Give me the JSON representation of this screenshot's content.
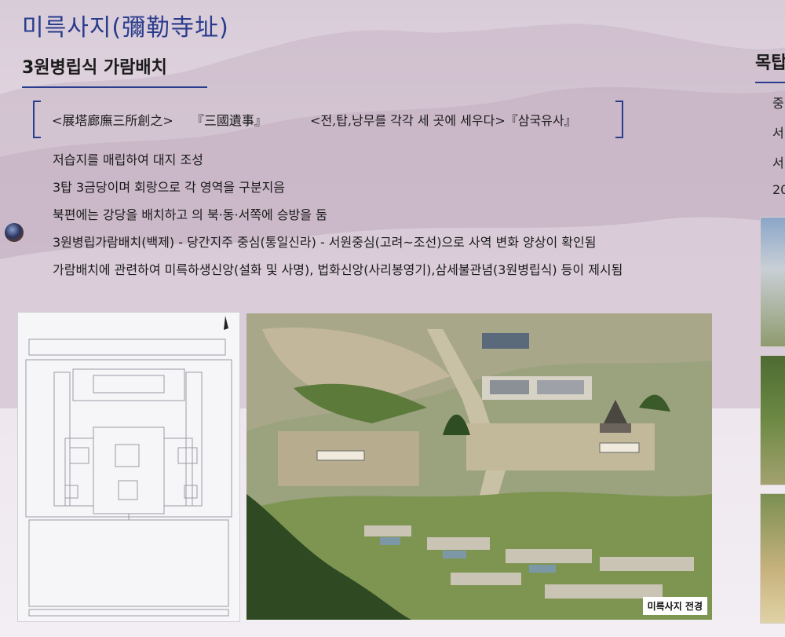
{
  "header": {
    "title": "미륵사지(彌勒寺址)",
    "subtitle": "3원병립식 가람배치",
    "right_title": "목탑",
    "right_lines": [
      "중",
      "서",
      "서",
      "20"
    ]
  },
  "quote": {
    "hanja": "<展塔廊廡三所創之>",
    "source_hanja": "『三國遺事』",
    "korean": "<전,탑,낭무를 각각 세 곳에 세우다>『삼국유사』"
  },
  "bullets": [
    "저습지를 매립하여 대지 조성",
    "3탑 3금당이며 회랑으로 각 영역을 구분지음",
    "북편에는 강당을 배치하고  의 북·동·서쪽에 승방을 둠",
    "3원병립가람배치(백제) - 당간지주 중심(통일신라) - 서원중심(고려~조선)으로 사역 변화 양상이 확인됨",
    "가람배치에 관련하여 미륵하생신앙(설화 및 사명), 법화신앙(사리봉영기),삼세불관념(3원병립식) 등이 제시됨"
  ],
  "photo": {
    "caption": "미륵사지 전경"
  },
  "colors": {
    "accent": "#2a3c8c",
    "text": "#1a1a1a"
  }
}
